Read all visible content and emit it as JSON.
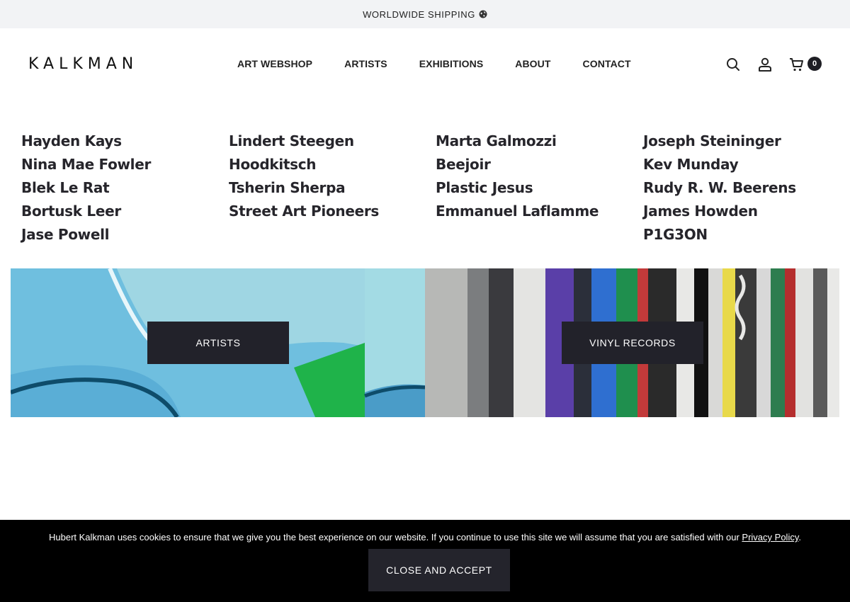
{
  "topbar": {
    "text": "WORLDWIDE SHIPPING",
    "icon": "globe-icon"
  },
  "header": {
    "logo": "KALKMAN",
    "nav": [
      "ART WEBSHOP",
      "ARTISTS",
      "EXHIBITIONS",
      "ABOUT",
      "CONTACT"
    ],
    "icons": [
      "search-icon",
      "user-icon",
      "cart-icon"
    ],
    "cart_count": "0"
  },
  "artists_menu": {
    "columns": [
      [
        "Hayden Kays",
        "Nina Mae Fowler",
        "Blek Le Rat",
        "Bortusk Leer",
        "Jase Powell"
      ],
      [
        "Lindert Steegen",
        "Hoodkitsch",
        "Tsherin Sherpa",
        "Street Art Pioneers"
      ],
      [
        "Marta Galmozzi",
        "Beejoir",
        "Plastic Jesus",
        "Emmanuel Laflamme"
      ],
      [
        "Joseph Steininger",
        "Kev Munday",
        "Rudy R. W. Beerens",
        "James Howden",
        "P1G3ON"
      ]
    ]
  },
  "banners": [
    {
      "label": "ARTISTS"
    },
    {
      "label": "VINYL RECORDS"
    }
  ],
  "cookie": {
    "text": "Hubert Kalkman uses cookies to ensure that we give you the best experience on our website. If you continue to use this site we will assume that you are satisfied with our ",
    "link": "Privacy Policy",
    "end": ".",
    "button": "CLOSE AND ACCEPT"
  },
  "colors": {
    "dark_button": "#22222a",
    "cookie_bg": "#000000",
    "topbar_bg": "#f2f3f5"
  }
}
